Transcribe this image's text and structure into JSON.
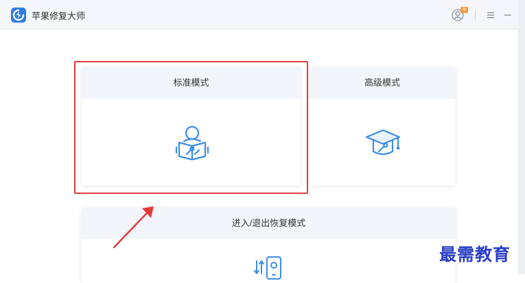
{
  "window": {
    "title": "苹果修复大师",
    "logo_icon": "app-logo-icon",
    "controls": {
      "user_icon": "user-avatar-icon",
      "vip_badge_icon": "vip-badge-icon",
      "menu_icon": "menu-icon",
      "minimize_icon": "minimize-icon"
    }
  },
  "modes": {
    "standard": {
      "label": "标准模式",
      "icon": "person-reading-repair-icon",
      "highlighted": true
    },
    "advanced": {
      "label": "高级模式",
      "icon": "graduation-cap-repair-icon"
    },
    "recovery": {
      "label": "进入/退出恢复模式",
      "icon": "phone-transfer-icon"
    }
  },
  "annotations": {
    "highlight_color": "#e23b3b",
    "arrow_color": "#e23b3b"
  },
  "watermark": {
    "text": "最需教育"
  },
  "colors": {
    "accent": "#3a8ee6",
    "card_header_bg": "#f2f5f9",
    "title_bar_bg": "#f4f6fa"
  }
}
